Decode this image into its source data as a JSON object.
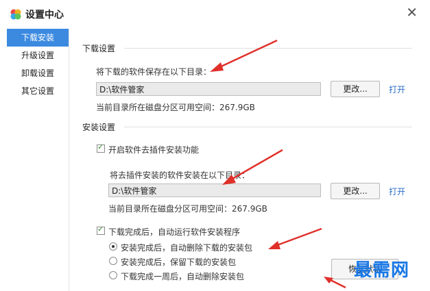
{
  "window": {
    "title": "设置中心",
    "close_glyph": "✕"
  },
  "sidebar": {
    "items": [
      {
        "label": "下载安装",
        "active": true
      },
      {
        "label": "升级设置",
        "active": false
      },
      {
        "label": "卸载设置",
        "active": false
      },
      {
        "label": "其它设置",
        "active": false
      }
    ]
  },
  "download": {
    "section_title": "下载设置",
    "save_label": "将下载的软件保存在以下目录：",
    "path": "D:\\软件管家",
    "change_button": "更改...",
    "open_link": "打开",
    "space_text": "当前目录所在磁盘分区可用空间：267.9GB"
  },
  "install": {
    "section_title": "安装设置",
    "plugin_checkbox": "开启软件去插件安装功能",
    "plugin_label": "将去插件安装的软件安装在以下目录：",
    "path": "D:\\软件管家",
    "change_button": "更改...",
    "open_link": "打开",
    "space_text": "当前目录所在磁盘分区可用空间：267.9GB",
    "auto_checkbox": "下载完成后，自动运行软件安装程序",
    "radio_options": [
      {
        "label": "安装完成后，自动删除下载的安装包",
        "selected": true
      },
      {
        "label": "安装完成后，保留下载的安装包",
        "selected": false
      },
      {
        "label": "下载完成一周后，自动删除安装包",
        "selected": false
      }
    ],
    "restore_button": "恢复默认"
  },
  "watermark": "最需网",
  "colors": {
    "accent": "#3c8ae0",
    "link": "#2a6cc9",
    "arrow": "#e0302a",
    "watermark": "#1a78e6"
  }
}
